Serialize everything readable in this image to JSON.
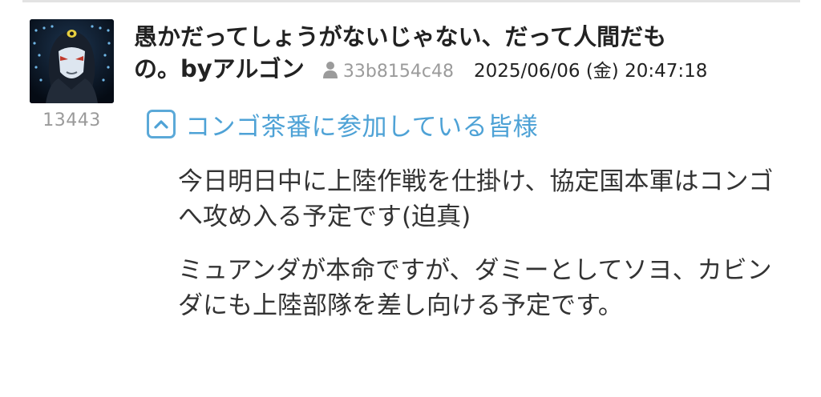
{
  "post": {
    "user_id": "13443",
    "title_line1": "愚かだってしょうがないじゃない、だって人間だも",
    "title_line2": "の。byアルゴン",
    "poster_hash": "33b8154c48",
    "date": "2025/06/06 (金) 20:47:18",
    "category_label": "コンゴ茶番に参加している皆様",
    "paragraphs": [
      "今日明日中に上陸作戦を仕掛け、協定国本軍はコンゴへ攻め入る予定です(迫真)",
      "ミュアンダが本命ですが、ダミーとしてソヨ、カビンダにも上陸部隊を差し向ける予定です。"
    ]
  },
  "colors": {
    "accent": "#4ea2d6",
    "muted": "#9b9b9b",
    "text": "#333333"
  },
  "icons": {
    "person": "person-icon",
    "chevron": "chevron-up-icon"
  }
}
